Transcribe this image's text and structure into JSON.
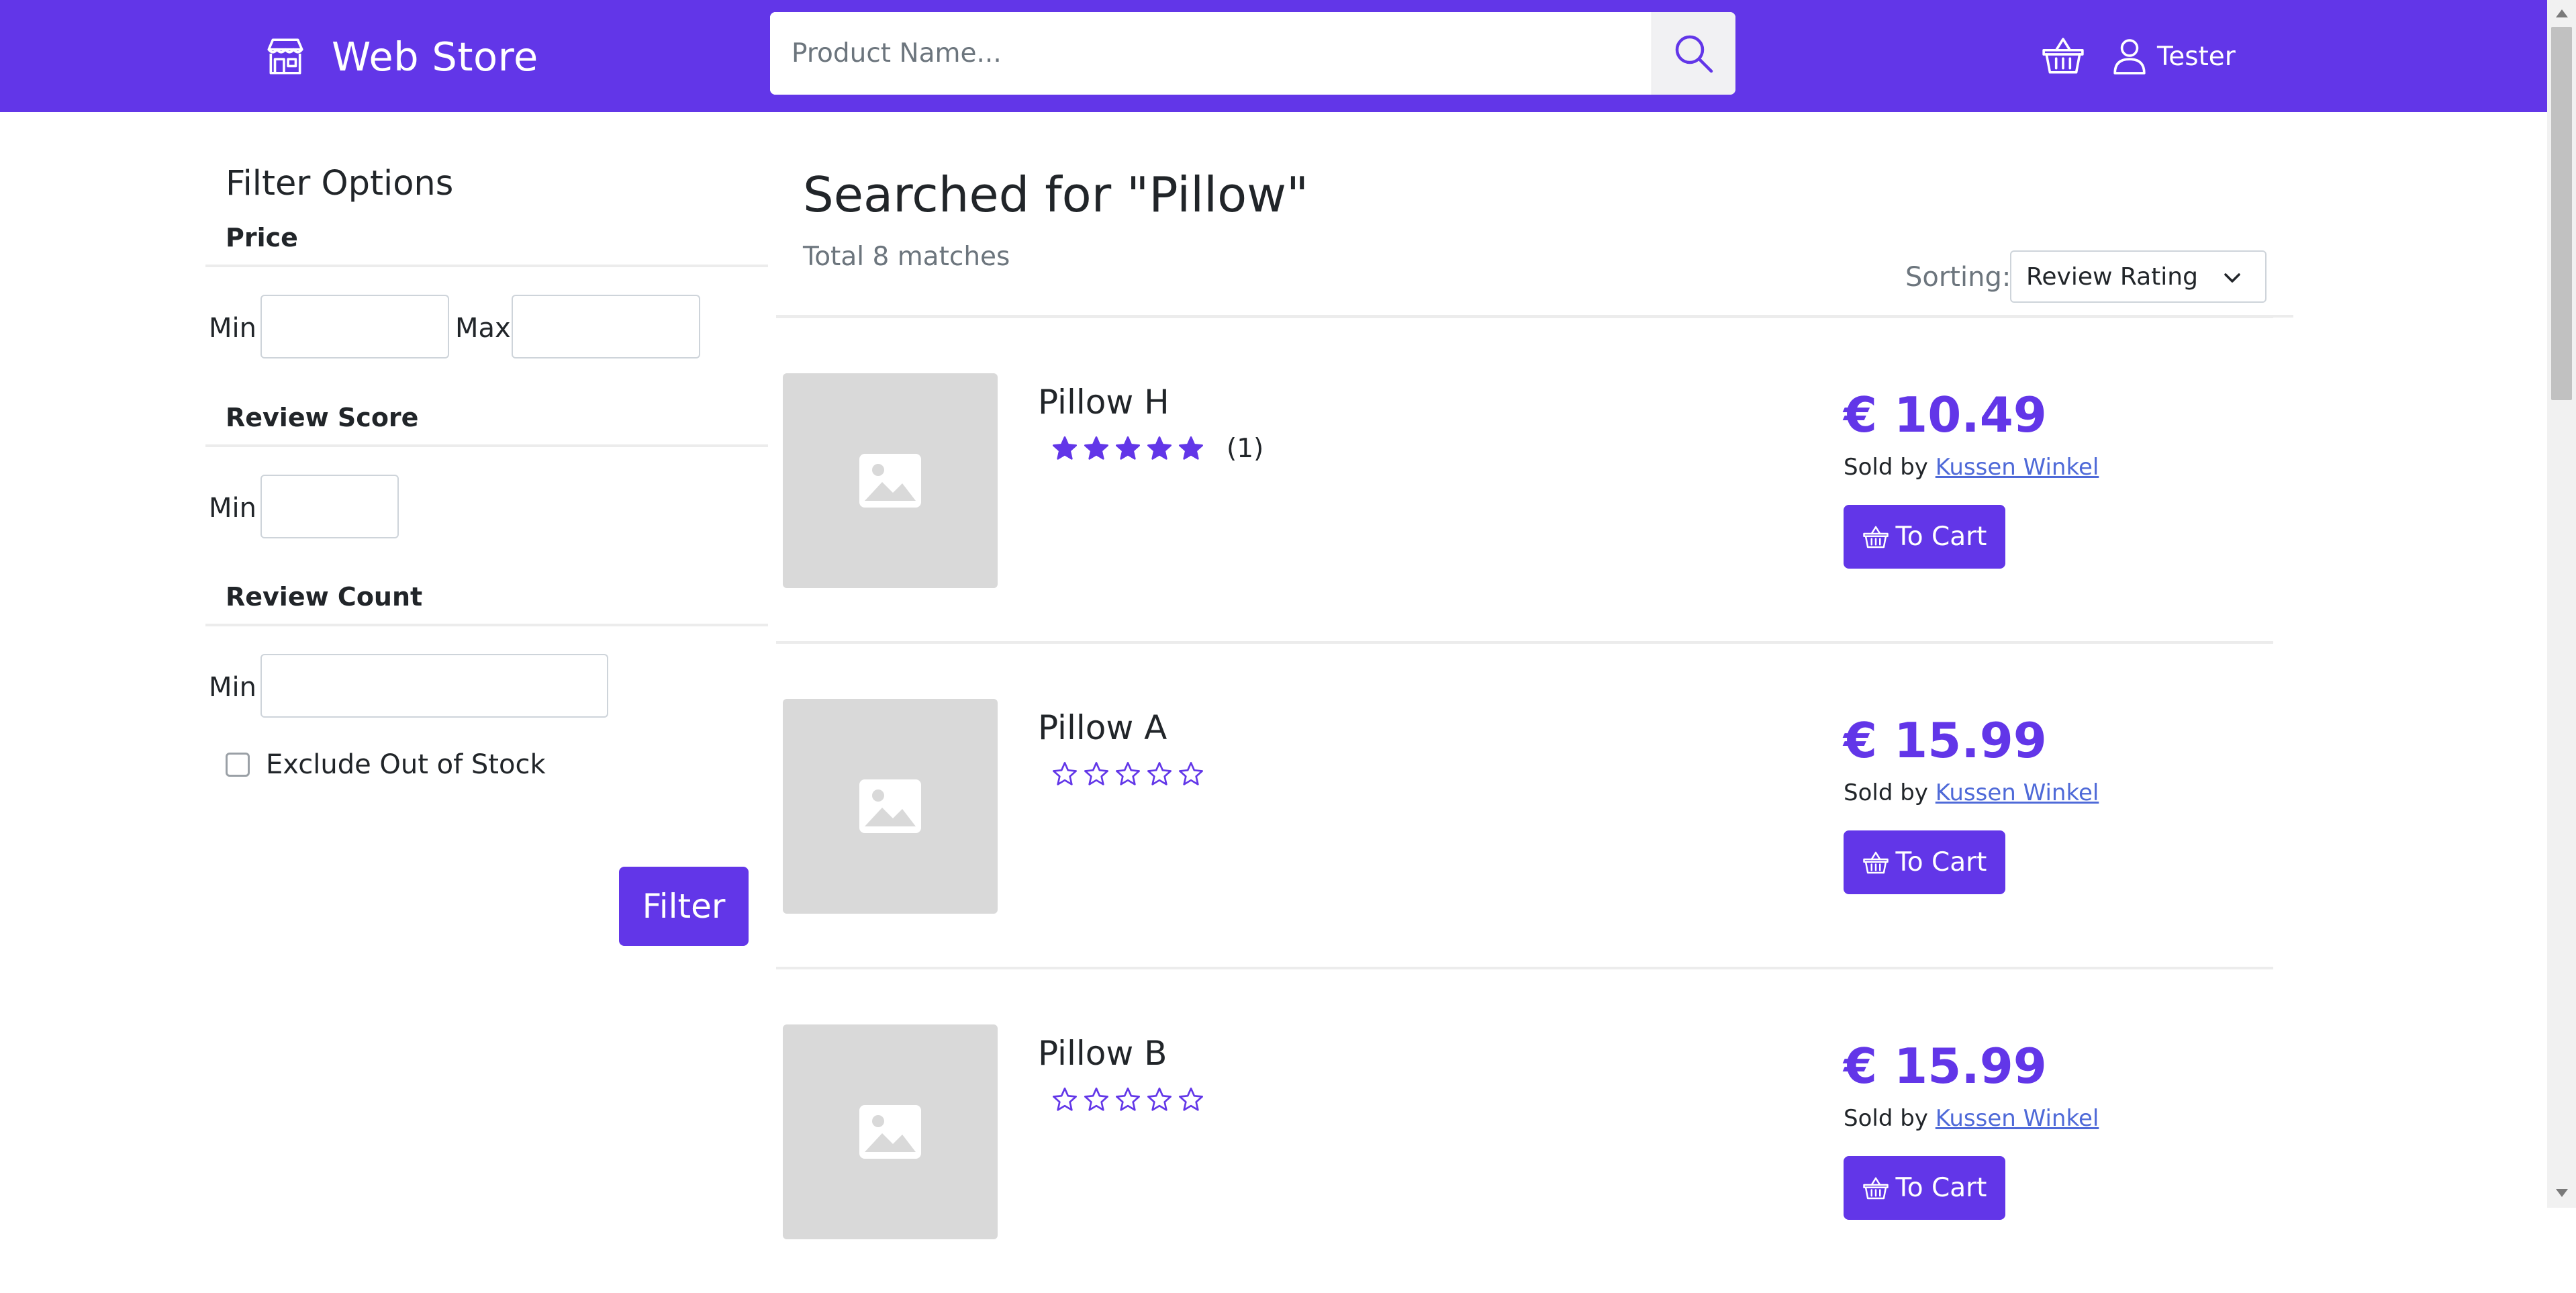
{
  "header": {
    "brand_name": "Web Store",
    "search_placeholder": "Product Name...",
    "username": "Tester",
    "brand_color": "#6236e8"
  },
  "filters": {
    "title": "Filter Options",
    "price": {
      "title": "Price",
      "min_label": "Min",
      "max_label": "Max",
      "min_value": "",
      "max_value": ""
    },
    "review_score": {
      "title": "Review Score",
      "min_label": "Min",
      "min_value": ""
    },
    "review_count": {
      "title": "Review Count",
      "min_label": "Min",
      "min_value": ""
    },
    "exclude_out_of_stock": {
      "label": "Exclude Out of Stock",
      "checked": false
    },
    "filter_button": "Filter"
  },
  "results": {
    "title": "Searched for \"Pillow\"",
    "count_text": "Total 8 matches",
    "sort_label": "Sorting:",
    "sort_selected": "Review Rating"
  },
  "products": [
    {
      "name": "Pillow H",
      "rating": 5,
      "review_count_text": "(1)",
      "price": "€ 10.49",
      "sold_by_prefix": "Sold by",
      "seller": "Kussen Winkel",
      "cart_label": "To Cart"
    },
    {
      "name": "Pillow A",
      "rating": 0,
      "review_count_text": "",
      "price": "€ 15.99",
      "sold_by_prefix": "Sold by",
      "seller": "Kussen Winkel",
      "cart_label": "To Cart"
    },
    {
      "name": "Pillow B",
      "rating": 0,
      "review_count_text": "",
      "price": "€ 15.99",
      "sold_by_prefix": "Sold by",
      "seller": "Kussen Winkel",
      "cart_label": "To Cart"
    }
  ],
  "icons": {
    "brand": "store-icon",
    "search": "search-icon",
    "basket": "basket-icon",
    "user": "user-icon",
    "product_placeholder": "image-placeholder-icon",
    "rating": "star-icon",
    "cart_button": "basket-icon",
    "sort": "chevron-down-icon"
  }
}
